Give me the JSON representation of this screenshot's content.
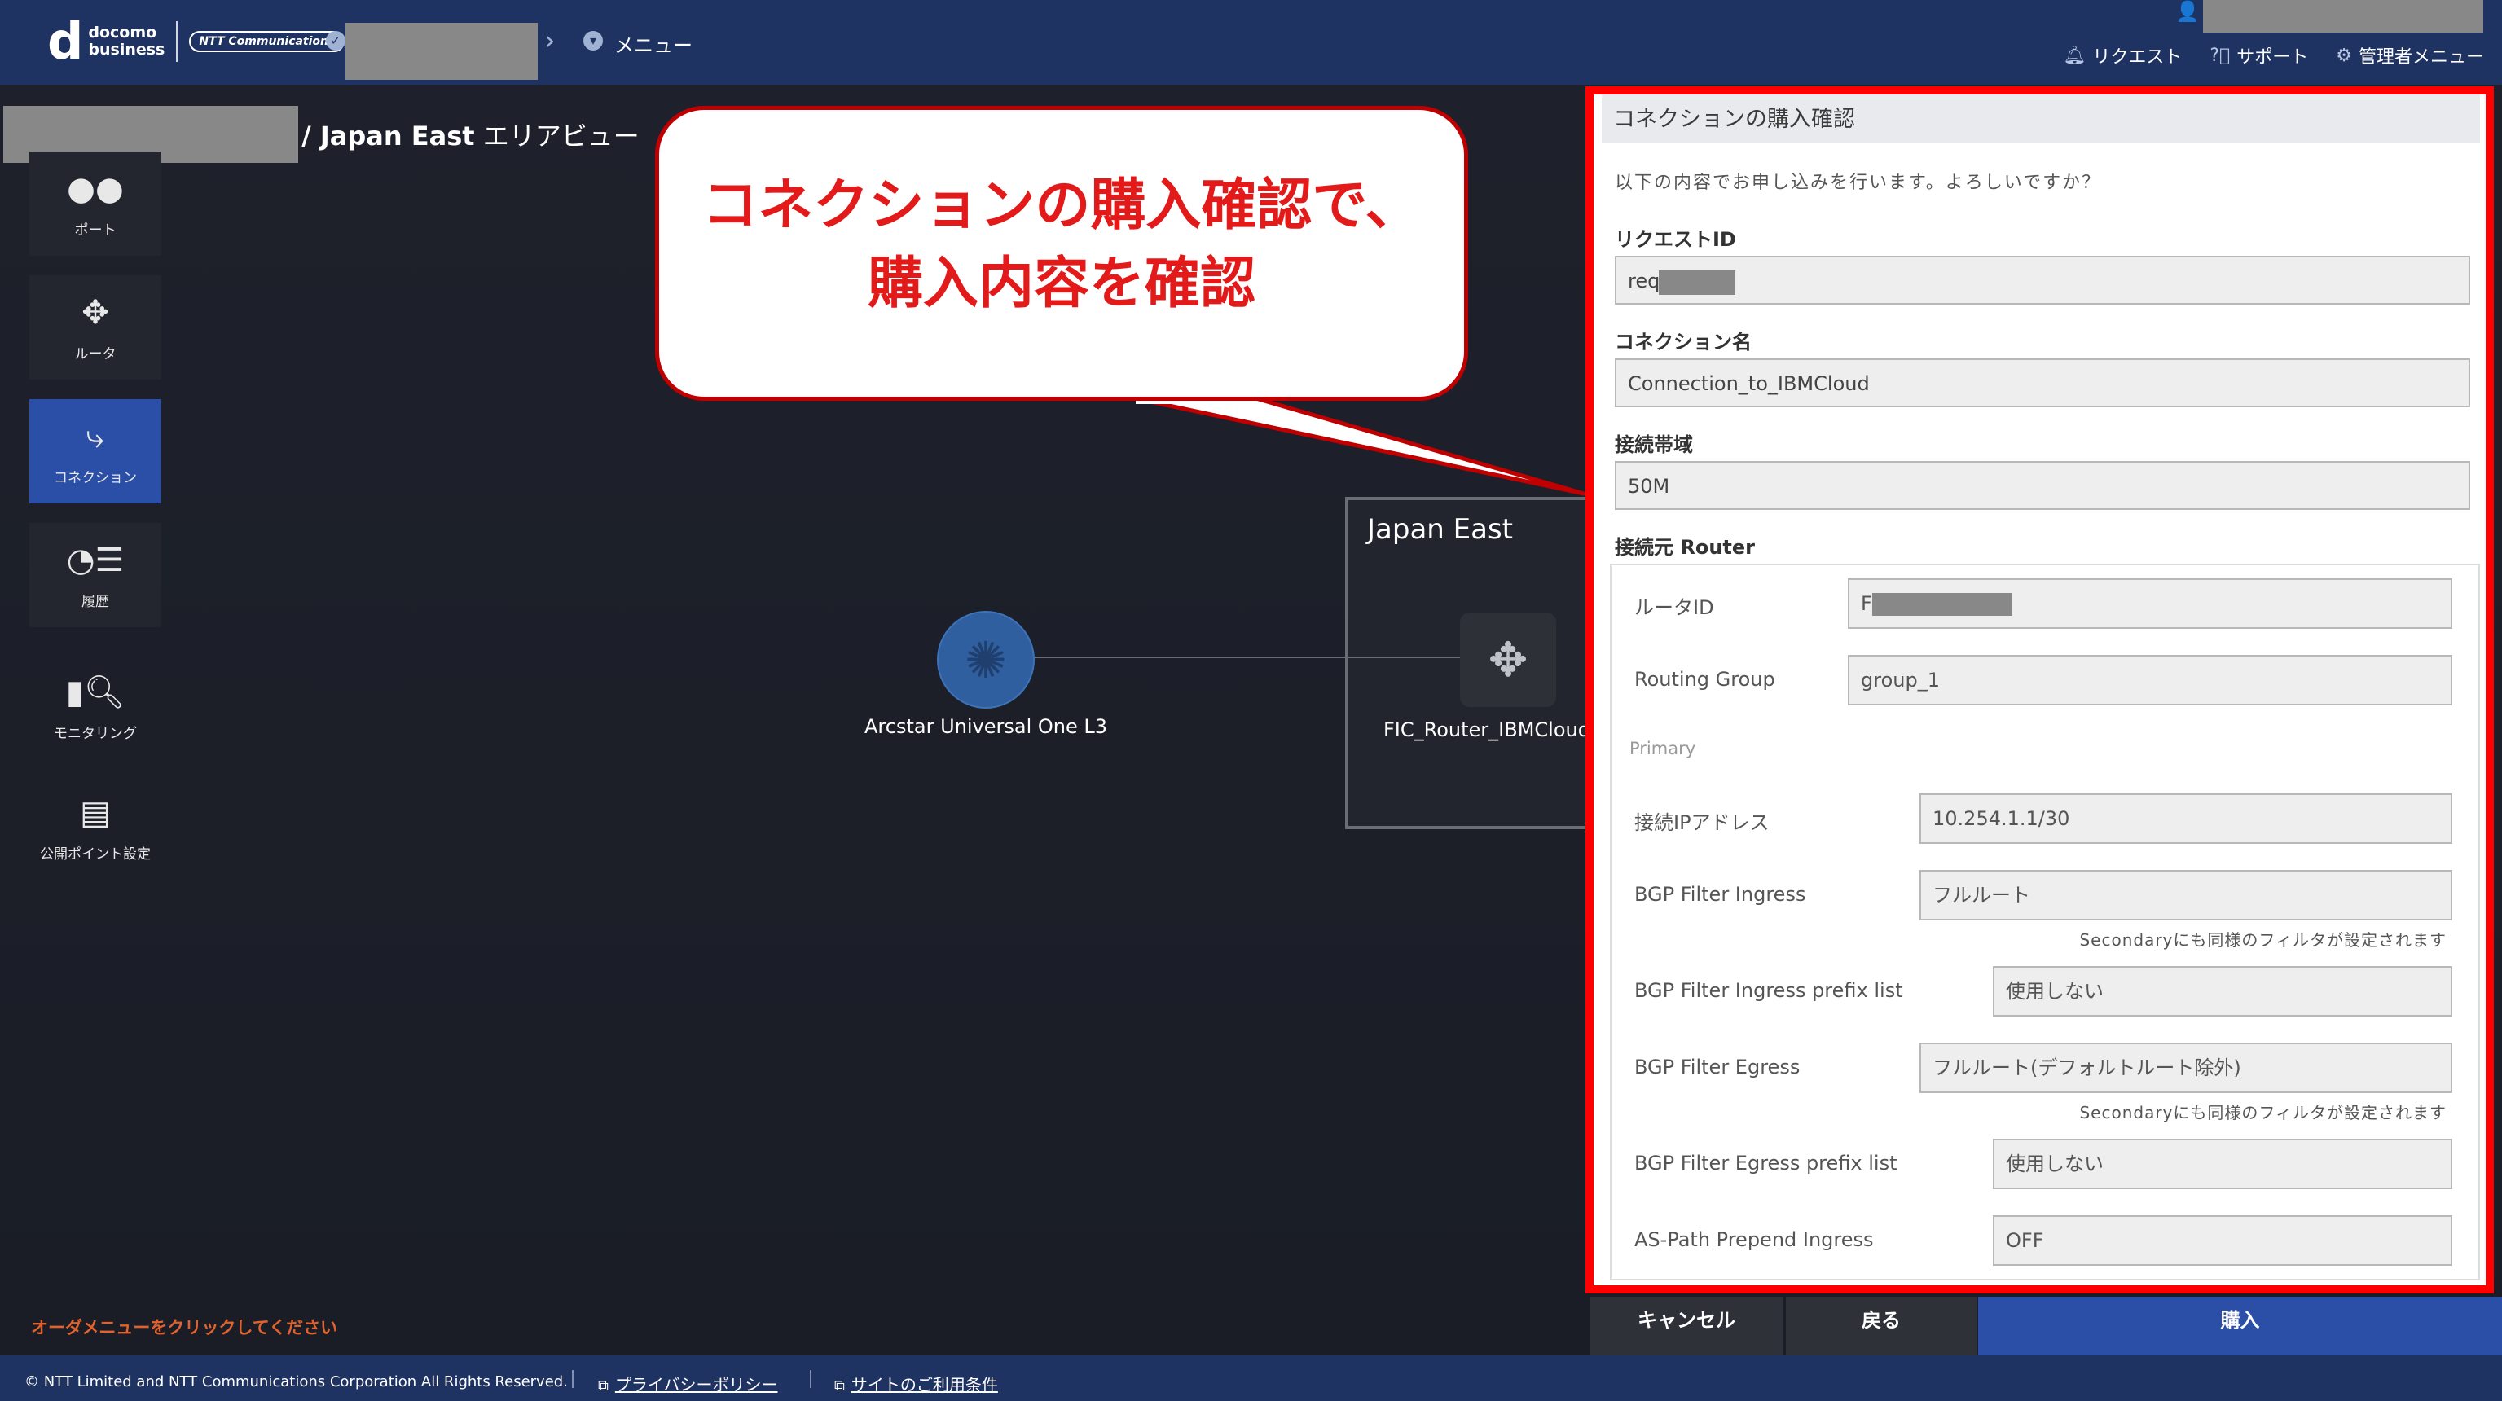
{
  "header": {
    "logo_d": "d",
    "logo_line1": "docomo",
    "logo_line2": "business",
    "logo_partner": "NTT Communications",
    "menu_label": "メニュー",
    "links": [
      {
        "label": "リクエスト",
        "icon": "bell-icon"
      },
      {
        "label": "サポート",
        "icon": "help-icon"
      },
      {
        "label": "管理者メニュー",
        "icon": "gear-icon"
      }
    ]
  },
  "breadcrumb": {
    "prefix": "/ Japan East",
    "suffix": " エリアビュー"
  },
  "sidebar": [
    {
      "label": "ポート",
      "icon": "port-icon",
      "active": false
    },
    {
      "label": "ルータ",
      "icon": "router-icon",
      "active": false
    },
    {
      "label": "コネクション",
      "icon": "connection-icon",
      "active": true
    },
    {
      "label": "履歴",
      "icon": "history-icon",
      "active": false
    },
    {
      "label": "モニタリング",
      "icon": "monitoring-icon",
      "active": false
    },
    {
      "label": "公開ポイント設定",
      "icon": "public-point-icon",
      "active": false
    }
  ],
  "map": {
    "region_title": "Japan East",
    "node_arcstar": "Arcstar Universal One L3",
    "node_router": "FIC_Router_IBMCloud"
  },
  "callout": {
    "line1": "コネクションの購入確認で、",
    "line2": "購入内容を確認",
    "border_color": "#c00000",
    "text_color": "#e31a1a"
  },
  "order_hint": "オーダメニューをクリックしてください",
  "dialog": {
    "title": "コネクションの購入確認",
    "message": "以下の内容でお申し込みを行います。よろしいですか？",
    "request_id_label": "リクエストID",
    "request_id_value": "req",
    "connection_name_label": "コネクション名",
    "connection_name_value": "Connection_to_IBMCloud",
    "bandwidth_label": "接続帯域",
    "bandwidth_value": "50M",
    "source_router_label": "接続元 Router",
    "router_id_label": "ルータID",
    "router_id_value": "F",
    "routing_group_label": "Routing Group",
    "routing_group_value": "group_1",
    "primary_label": "Primary",
    "ip_label": "接続IPアドレス",
    "ip_value": "10.254.1.1/30",
    "ingress_label": "BGP Filter Ingress",
    "ingress_value": "フルルート",
    "ingress_note": "Secondaryにも同様のフィルタが設定されます",
    "ingress_prefix_label": "BGP Filter Ingress prefix list",
    "ingress_prefix_value": "使用しない",
    "egress_label": "BGP Filter Egress",
    "egress_value": "フルルート(デフォルトルート除外)",
    "egress_note": "Secondaryにも同様のフィルタが設定されます",
    "egress_prefix_label": "BGP Filter Egress prefix list",
    "egress_prefix_value": "使用しない",
    "aspath_label": "AS-Path Prepend Ingress",
    "aspath_value": "OFF",
    "highlight_color": "#ff0000"
  },
  "buttons": {
    "cancel": "キャンセル",
    "back": "戻る",
    "buy": "購入"
  },
  "footer": {
    "copyright": "© NTT Limited and NTT Communications Corporation All Rights Reserved.",
    "privacy": "プライバシーポリシー",
    "terms": "サイトのご利用条件"
  }
}
